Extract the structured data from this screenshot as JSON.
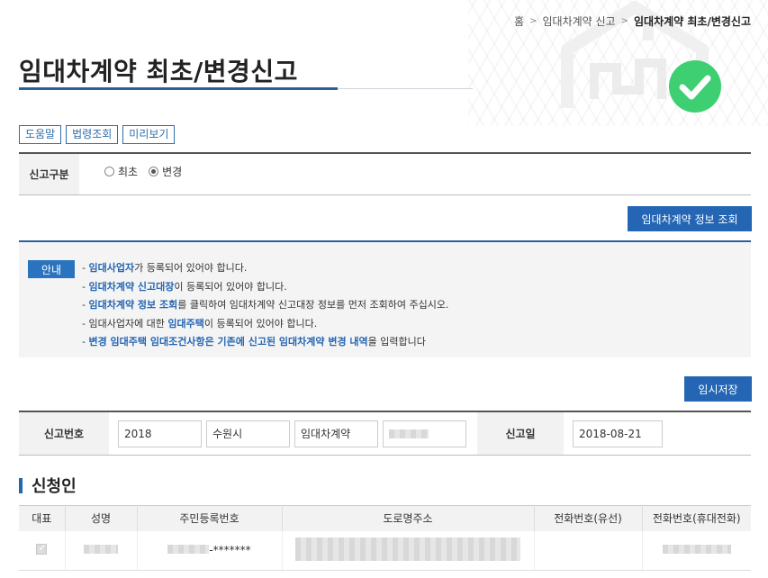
{
  "breadcrumb": {
    "home": "홈",
    "level1": "임대차계약 신고",
    "current": "임대차계약 최초/변경신고"
  },
  "page": {
    "title": "임대차계약 최초/변경신고"
  },
  "tools": {
    "help": "도움말",
    "law": "법령조회",
    "preview": "미리보기"
  },
  "report_type": {
    "label": "신고구분",
    "options": [
      {
        "label": "최초",
        "selected": false
      },
      {
        "label": "변경",
        "selected": true
      }
    ]
  },
  "actions": {
    "lookup": "임대차계약 정보 조회",
    "temp_save": "임시저장"
  },
  "notice": {
    "badge": "안내",
    "items": [
      {
        "strong": "임대사업자",
        "rest": "가 등록되어 있어야 합니다."
      },
      {
        "strong": "임대차계약 신고대장",
        "rest": "이 등록되어 있어야 합니다."
      },
      {
        "strong": "임대차계약 정보 조회",
        "rest": "를 클릭하여 임대차계약 신고대장 정보를 먼저 조회하여 주십시오."
      },
      {
        "pre": "임대사업자에 대한 ",
        "strong": "임대주택",
        "rest": "이 등록되어 있어야 합니다."
      },
      {
        "strong": "변경 임대주택 임대조건사항은 기존에 신고된 임대차계약 변경 내역",
        "rest": "을 입력합니다"
      }
    ]
  },
  "report_number": {
    "label": "신고번호",
    "year": "2018",
    "city": "수원시",
    "kind": "임대차계약",
    "date_label": "신고일",
    "date": "2018-08-21"
  },
  "applicant": {
    "section_title": "신청인",
    "columns": [
      "대표",
      "성명",
      "주민등록번호",
      "도로명주소",
      "전화번호(유선)",
      "전화번호(휴대전화)"
    ],
    "row": {
      "rrn_suffix": "-*******"
    }
  },
  "colors": {
    "accent": "#2466b3",
    "check_green": "#3ecf72"
  }
}
